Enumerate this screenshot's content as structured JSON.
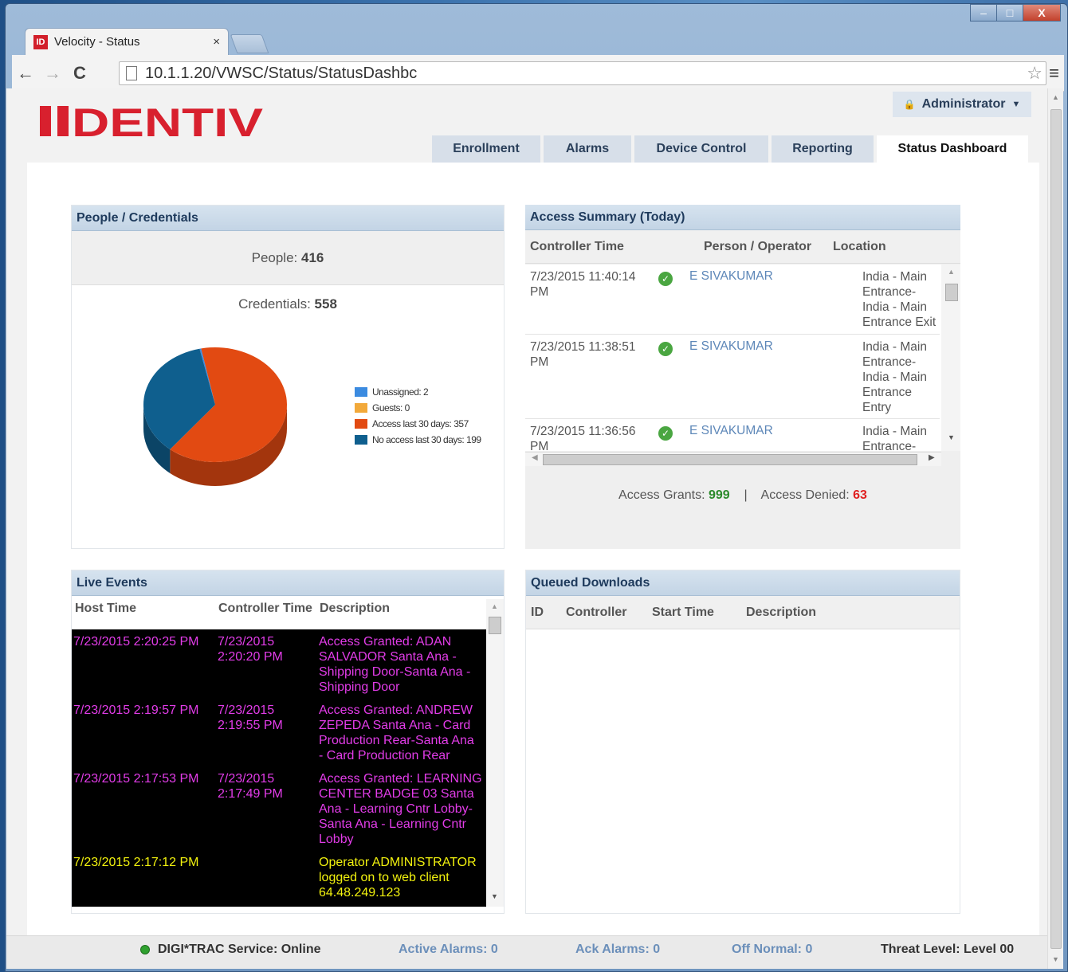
{
  "browser": {
    "tab_title": "Velocity - Status",
    "tab_icon": "ID",
    "url": "10.1.1.20/VWSC/Status/StatusDashbc",
    "close": "×"
  },
  "window_controls": {
    "minimize": "–",
    "maximize": "□",
    "close": "X"
  },
  "header": {
    "logo": "IDENTIV",
    "user": "Administrator"
  },
  "nav_tabs": [
    "Enrollment",
    "Alarms",
    "Device Control",
    "Reporting",
    "Status Dashboard"
  ],
  "people": {
    "title": "People / Credentials",
    "people_label": "People:",
    "people_value": "416",
    "cred_label": "Credentials:",
    "cred_value": "558"
  },
  "chart_data": {
    "type": "pie",
    "series": [
      {
        "name": "Unassigned: 2",
        "value": 2,
        "color": "#3b8be0"
      },
      {
        "name": "Guests: 0",
        "value": 0,
        "color": "#f2a93a"
      },
      {
        "name": "Access last 30 days: 357",
        "value": 357,
        "color": "#e24a12"
      },
      {
        "name": "No access last 30 days: 199",
        "value": 199,
        "color": "#0f5f8e"
      }
    ],
    "legend": "right"
  },
  "access": {
    "title": "Access Summary (Today)",
    "col_time": "Controller Time",
    "col_person": "Person / Operator",
    "col_location": "Location",
    "rows": [
      {
        "time1": "7/23/2015 11:40:14",
        "time2": "PM",
        "person": "E SIVAKUMAR",
        "loc": [
          "India - Main",
          "Entrance-",
          "India - Main",
          "Entrance Exit"
        ]
      },
      {
        "time1": "7/23/2015 11:38:51",
        "time2": "PM",
        "person": "E SIVAKUMAR",
        "loc": [
          "India - Main",
          "Entrance-",
          "India - Main",
          "Entrance",
          "Entry"
        ]
      },
      {
        "time1": "7/23/2015 11:36:56",
        "time2": "PM",
        "person": "E SIVAKUMAR",
        "loc": [
          "India - Main",
          "Entrance-"
        ]
      }
    ],
    "grants_label": "Access Grants:",
    "grants": "999",
    "sep": "|",
    "denied_label": "Access Denied:",
    "denied": "63"
  },
  "live": {
    "title": "Live Events",
    "col_host": "Host Time",
    "col_ctrl": "Controller Time",
    "col_desc": "Description",
    "events": [
      {
        "host": "7/23/2015 2:20:25 PM",
        "ctrl": [
          "7/23/2015",
          "2:20:20 PM"
        ],
        "desc": [
          "Access Granted: ADAN",
          "SALVADOR Santa Ana -",
          "Shipping Door-Santa Ana -",
          "Shipping Door"
        ],
        "color": "#e23ce8"
      },
      {
        "host": "7/23/2015 2:19:57 PM",
        "ctrl": [
          "7/23/2015",
          "2:19:55 PM"
        ],
        "desc": [
          "Access Granted: ANDREW",
          "ZEPEDA Santa Ana - Card",
          "Production Rear-Santa Ana",
          "- Card Production Rear"
        ],
        "color": "#e23ce8"
      },
      {
        "host": "7/23/2015 2:17:53 PM",
        "ctrl": [
          "7/23/2015",
          "2:17:49 PM"
        ],
        "desc": [
          "Access Granted: LEARNING",
          "CENTER BADGE 03 Santa",
          "Ana - Learning Cntr Lobby-",
          "Santa Ana - Learning Cntr",
          "Lobby"
        ],
        "color": "#e23ce8"
      },
      {
        "host": "7/23/2015 2:17:12 PM",
        "ctrl": [],
        "desc": [
          "Operator ADMINISTRATOR",
          "logged on to web client",
          "64.48.249.123"
        ],
        "color": "#f2f20e"
      }
    ]
  },
  "queued": {
    "title": "Queued Downloads",
    "col_id": "ID",
    "col_ctrl": "Controller",
    "col_start": "Start Time",
    "col_desc": "Description"
  },
  "footer": {
    "service": "DIGI*TRAC Service: Online",
    "active": "Active Alarms: 0",
    "ack": "Ack Alarms: 0",
    "offnormal": "Off Normal: 0",
    "threat": "Threat Level: Level 00"
  }
}
